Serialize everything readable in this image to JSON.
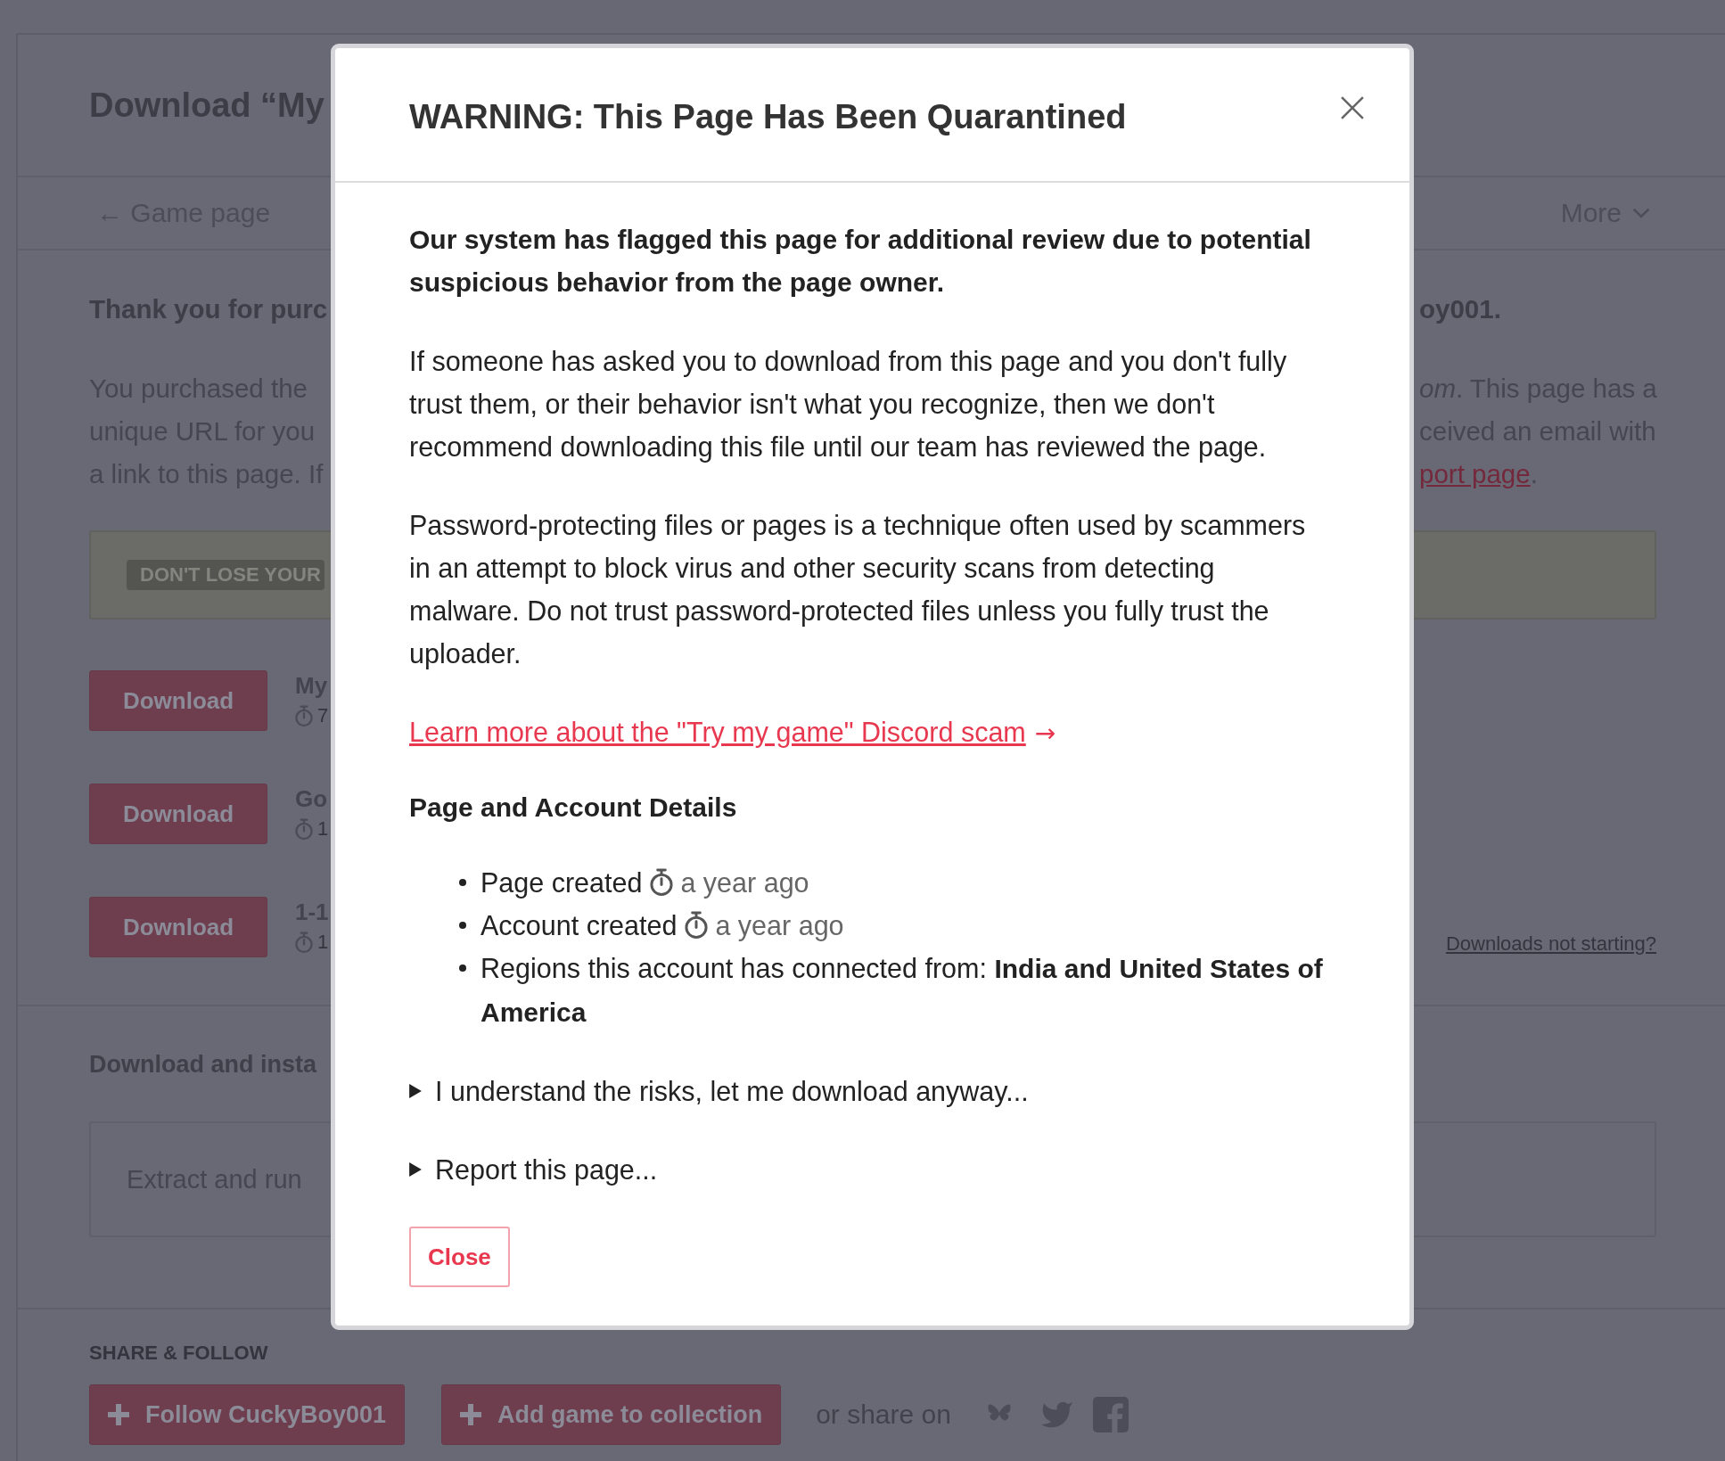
{
  "background_page": {
    "title": "Download “My",
    "back_link": "← Game page",
    "more_menu": "More",
    "thanks": {
      "left": "Thank you for purc",
      "right": "oy001."
    },
    "intro_lines": [
      {
        "left": "You purchased the",
        "right": "*om*. This page has a"
      },
      {
        "left": "unique URL for you",
        "right": "ceived an email with"
      },
      {
        "left": "a link to this page. If",
        "right_link": "port page",
        "right": "."
      }
    ],
    "notice_badge": "DON'T LOSE YOUR",
    "downloads": [
      {
        "button": "Download",
        "title": "My",
        "meta": "7"
      },
      {
        "button": "Download",
        "title": "Go",
        "meta": "1"
      },
      {
        "button": "Download",
        "title": "1-1",
        "meta": "1"
      }
    ],
    "downloads_help_link": "Downloads not starting?",
    "install_heading": "Download and insta",
    "install_instructions": "Extract and run",
    "share": {
      "heading": "SHARE & FOLLOW",
      "follow_button": "Follow CuckyBoy001",
      "collection_button": "Add game to collection",
      "share_label": "or share on"
    }
  },
  "modal": {
    "title": "WARNING: This Page Has Been Quarantined",
    "lead": "Our system has flagged this page for additional review due to potential suspicious behavior from the page owner.",
    "paragraphs": [
      "If someone has asked you to download from this page and you don't fully trust them, or their behavior isn't what you recognize, then we don't recommend downloading this file until our team has reviewed the page.",
      "Password-protecting files or pages is a technique often used by scammers in an attempt to block virus and other security scans from detecting malware. Do not trust password-protected files unless you fully trust the uploader."
    ],
    "learn_more_link": {
      "label": "Learn more about the \"Try my game\" Discord scam",
      "arrow": "→"
    },
    "details_heading": "Page and Account Details",
    "details": [
      {
        "kind": "timestamp",
        "label": "Page created",
        "time": "a year ago"
      },
      {
        "kind": "timestamp",
        "label": "Account created",
        "time": "a year ago"
      },
      {
        "kind": "text",
        "text": "Regions this account has connected from: **India and United States of America**"
      }
    ],
    "disclosures": [
      {
        "summary": "I understand the risks, let me download anyway...",
        "expanded": false
      },
      {
        "summary": "Report this page...",
        "expanded": false
      }
    ],
    "close_button": "Close"
  }
}
